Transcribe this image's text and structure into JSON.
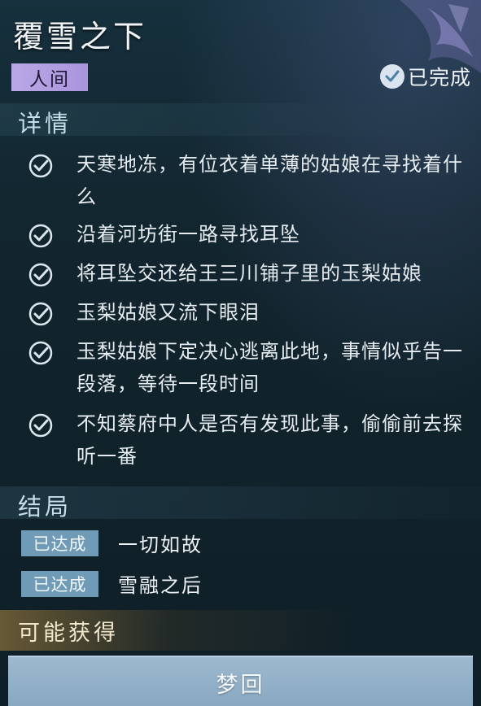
{
  "quest": {
    "title": "覆雪之下",
    "tag": "人间",
    "status": "已完成"
  },
  "details": {
    "heading": "详情",
    "tasks": [
      "天寒地冻，有位衣着单薄的姑娘在寻找着什么",
      "沿着河坊街一路寻找耳坠",
      "将耳坠交还给王三川铺子里的玉梨姑娘",
      "玉梨姑娘又流下眼泪",
      "玉梨姑娘下定决心逃离此地，事情似乎告一段落，等待一段时间",
      "不知蔡府中人是否有发现此事，偷偷前去探听一番"
    ]
  },
  "endings": {
    "heading": "结局",
    "items": [
      {
        "badge": "已达成",
        "name": "一切如故"
      },
      {
        "badge": "已达成",
        "name": "雪融之后"
      }
    ]
  },
  "rewards": {
    "heading": "可能获得",
    "item": "梦回"
  },
  "colors": {
    "tag_bg": "#b9a8e6",
    "badge_bg": "#6f9bb6",
    "check": "#dbe6ee"
  }
}
